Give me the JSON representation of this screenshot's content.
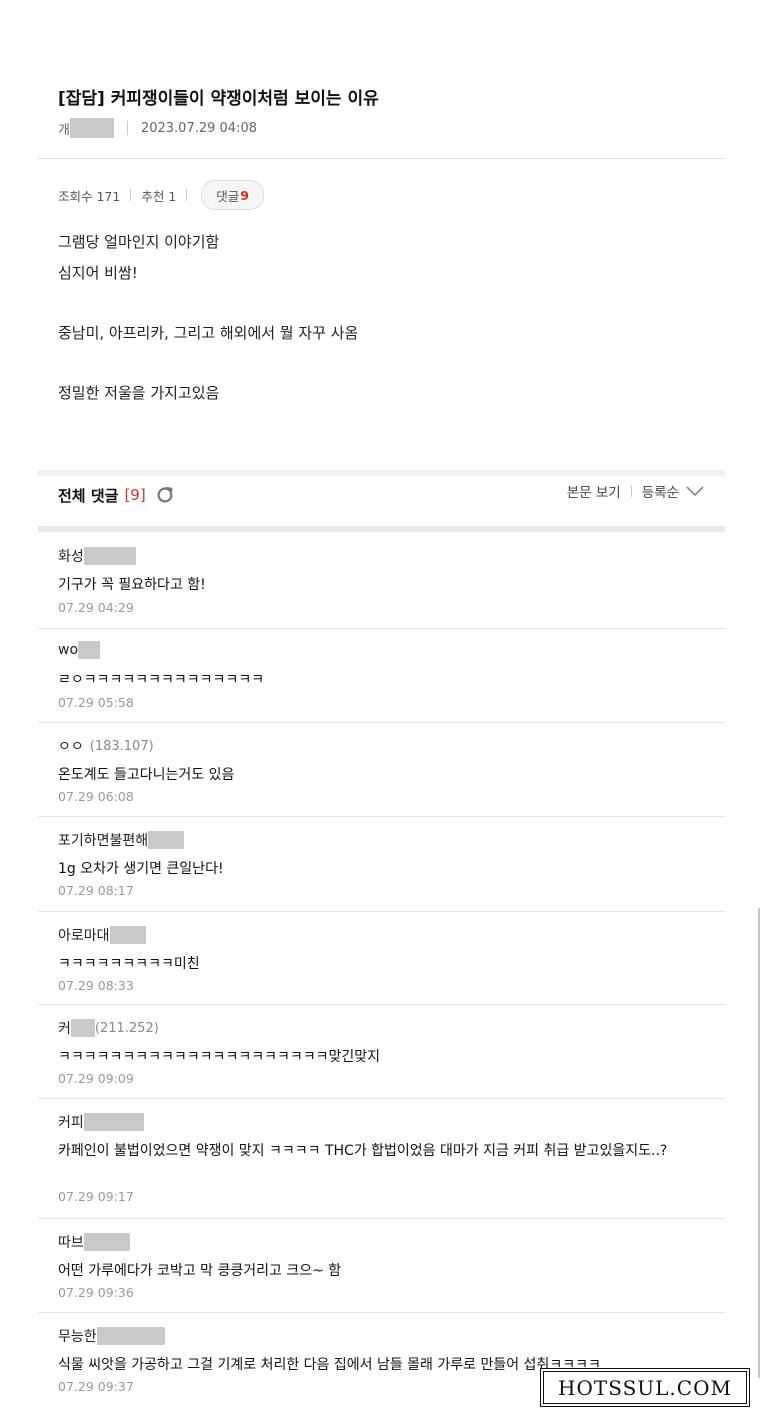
{
  "post": {
    "title": "[잡담] 커피쟁이들이 약쟁이처럼 보이는 이유",
    "author_prefix": "개",
    "datetime": "2023.07.29 04:08",
    "views_label": "조회수 171",
    "likes_label": "추천 1",
    "comment_label": "댓글",
    "comment_count": "9",
    "body": {
      "line1": "그램당 얼마인지 이야기함",
      "line2": "심지어 비쌈!",
      "line3": "중남미, 아프리카, 그리고 해외에서 뭘 자꾸 사옴",
      "line4": "정밀한 저울을 가지고있음"
    }
  },
  "comments_header": {
    "title": "전체 댓글",
    "count": "[9]",
    "view_body": "본문 보기",
    "sort": "등록순"
  },
  "comments": [
    {
      "author": "화성",
      "ip": "",
      "text": "기구가 꼭 필요하다고 함!",
      "date": "07.29 04:29"
    },
    {
      "author": "wo",
      "ip": "",
      "text": "ㄹㅇㅋㅋㅋㅋㅋㅋㅋㅋㅋㅋㅋㅋㅋㅋ",
      "date": "07.29 05:58"
    },
    {
      "author": "ㅇㅇ",
      "ip": "(183.107)",
      "text": "온도계도 들고다니는거도 있음",
      "date": "07.29 06:08"
    },
    {
      "author": "포기하면불편해",
      "ip": "",
      "text": "1g 오차가 생기면 큰일난다!",
      "date": "07.29 08:17"
    },
    {
      "author": "아로마대",
      "ip": "",
      "text": "ㅋㅋㅋㅋㅋㅋㅋㅋㅋ미친",
      "date": "07.29 08:33"
    },
    {
      "author": "커",
      "ip": "(211.252)",
      "text": "ㅋㅋㅋㅋㅋㅋㅋㅋㅋㅋㅋㅋㅋㅋㅋㅋㅋㅋㅋㅋㅋ맞긴맞지",
      "date": "07.29 09:09"
    },
    {
      "author": "커피",
      "ip": "",
      "text": "카페인이 불법이었으면 약쟁이 맞지 ㅋㅋㅋㅋ THC가 합법이었음 대마가 지금 커피 취급 받고있을지도..?",
      "date": "07.29 09:17"
    },
    {
      "author": "따브",
      "ip": "",
      "text": "어떤 가루에다가 코박고 막 킁킁거리고 크으~ 함",
      "date": "07.29 09:36"
    },
    {
      "author": "무능한",
      "ip": "",
      "text": "식물 씨앗을 가공하고 그걸 기계로 처리한 다음 집에서 남들 몰래 가루로 만들어 섭취ㅋㅋㅋㅋ",
      "date": "07.29 09:37"
    }
  ],
  "watermark": "HOTSSUL.COM",
  "colors": {
    "accent_red": "#e1261c",
    "count_red": "#c53a2a",
    "muted": "#999999"
  }
}
